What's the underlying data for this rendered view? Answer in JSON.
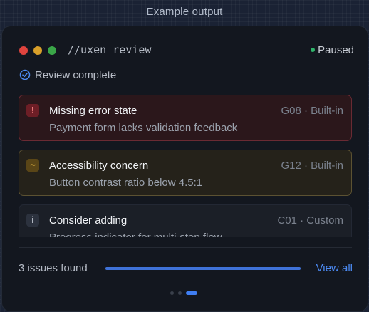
{
  "header": {
    "label": "Example output"
  },
  "window": {
    "command": "//uxen review",
    "status": "Paused"
  },
  "review": {
    "label": "Review complete"
  },
  "issues": [
    {
      "severity": "error",
      "icon": "!",
      "title": "Missing error state",
      "meta": "G08 · Built-in",
      "description": "Payment form lacks validation feedback"
    },
    {
      "severity": "warning",
      "icon": "~",
      "title": "Accessibility concern",
      "meta": "G12 · Built-in",
      "description": "Button contrast ratio below 4.5:1"
    },
    {
      "severity": "info",
      "icon": "i",
      "title": "Consider adding",
      "meta": "C01 · Custom",
      "description": "Progress indicator for multi-step flow"
    }
  ],
  "footer": {
    "count": "3 issues found",
    "progress": 1.0,
    "view_all": "View all"
  },
  "pagination": {
    "pages": 3,
    "active": 3
  },
  "colors": {
    "accent": "#3f7ef2",
    "error": "#e0443e",
    "warning": "#d9a02a",
    "success": "#3aa648"
  }
}
